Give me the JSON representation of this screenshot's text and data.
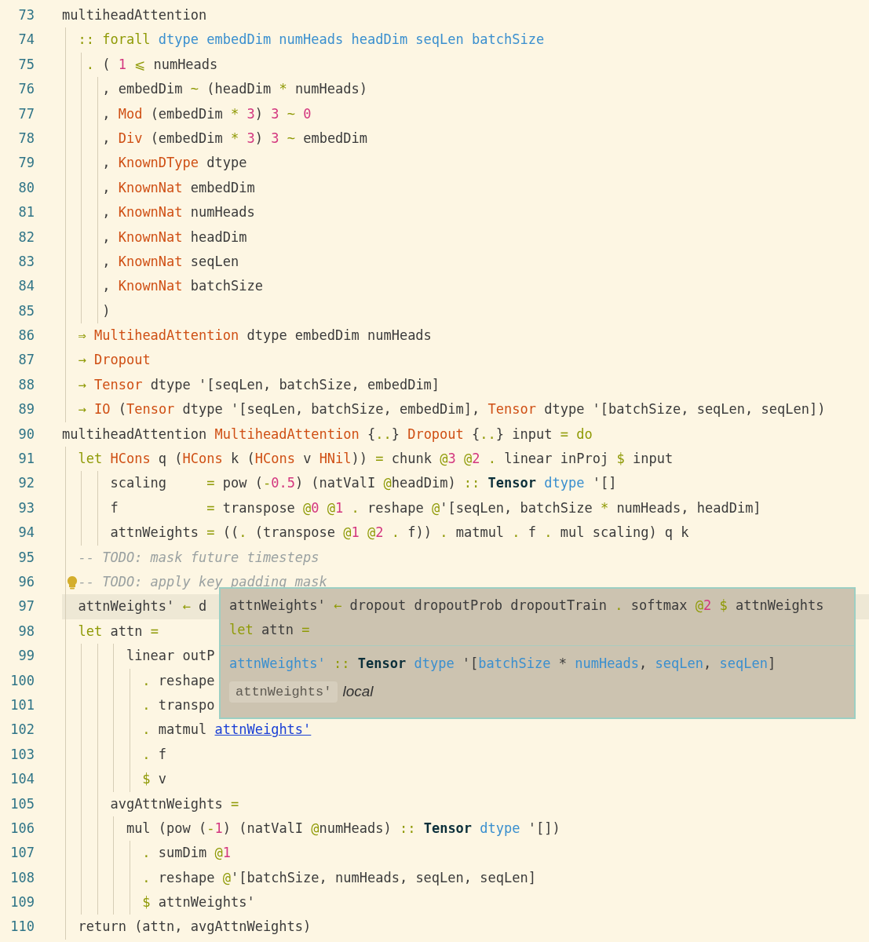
{
  "lines": [
    {
      "number": "73",
      "current": false,
      "lightbulb": false,
      "tokens": [
        {
          "text": "multiheadAttention",
          "kind": "plain"
        }
      ]
    },
    {
      "number": "74",
      "current": false,
      "lightbulb": false,
      "tokens": [
        {
          "text": "  :: forall",
          "kind": "op"
        },
        {
          "text": " dtype embedDim numHeads headDim seqLen batchSize",
          "kind": "tyvar"
        }
      ]
    },
    {
      "number": "75",
      "current": false,
      "lightbulb": false,
      "tokens": [
        {
          "text": "   .",
          "kind": "op"
        },
        {
          "text": " ( ",
          "kind": "plain"
        },
        {
          "text": "1",
          "kind": "num"
        },
        {
          "text": " ⩽",
          "kind": "op"
        },
        {
          "text": " numHeads",
          "kind": "plain"
        }
      ]
    },
    {
      "number": "76",
      "current": false,
      "lightbulb": false,
      "tokens": [
        {
          "text": "     , embedDim",
          "kind": "plain"
        },
        {
          "text": " ~",
          "kind": "op"
        },
        {
          "text": " (headDim",
          "kind": "plain"
        },
        {
          "text": " *",
          "kind": "op"
        },
        {
          "text": " numHeads)",
          "kind": "plain"
        }
      ]
    },
    {
      "number": "77",
      "current": false,
      "lightbulb": false,
      "tokens": [
        {
          "text": "     , ",
          "kind": "plain"
        },
        {
          "text": "Mod",
          "kind": "con"
        },
        {
          "text": " (embedDim",
          "kind": "plain"
        },
        {
          "text": " *",
          "kind": "op"
        },
        {
          "text": " 3",
          "kind": "num"
        },
        {
          "text": ") ",
          "kind": "plain"
        },
        {
          "text": "3",
          "kind": "num"
        },
        {
          "text": " ~",
          "kind": "op"
        },
        {
          "text": " 0",
          "kind": "num"
        }
      ]
    },
    {
      "number": "78",
      "current": false,
      "lightbulb": false,
      "tokens": [
        {
          "text": "     , ",
          "kind": "plain"
        },
        {
          "text": "Div",
          "kind": "con"
        },
        {
          "text": " (embedDim",
          "kind": "plain"
        },
        {
          "text": " *",
          "kind": "op"
        },
        {
          "text": " 3",
          "kind": "num"
        },
        {
          "text": ") ",
          "kind": "plain"
        },
        {
          "text": "3",
          "kind": "num"
        },
        {
          "text": " ~",
          "kind": "op"
        },
        {
          "text": " embedDim",
          "kind": "plain"
        }
      ]
    },
    {
      "number": "79",
      "current": false,
      "lightbulb": false,
      "tokens": [
        {
          "text": "     , ",
          "kind": "plain"
        },
        {
          "text": "KnownDType",
          "kind": "con"
        },
        {
          "text": " dtype",
          "kind": "plain"
        }
      ]
    },
    {
      "number": "80",
      "current": false,
      "lightbulb": false,
      "tokens": [
        {
          "text": "     , ",
          "kind": "plain"
        },
        {
          "text": "KnownNat",
          "kind": "con"
        },
        {
          "text": " embedDim",
          "kind": "plain"
        }
      ]
    },
    {
      "number": "81",
      "current": false,
      "lightbulb": false,
      "tokens": [
        {
          "text": "     , ",
          "kind": "plain"
        },
        {
          "text": "KnownNat",
          "kind": "con"
        },
        {
          "text": " numHeads",
          "kind": "plain"
        }
      ]
    },
    {
      "number": "82",
      "current": false,
      "lightbulb": false,
      "tokens": [
        {
          "text": "     , ",
          "kind": "plain"
        },
        {
          "text": "KnownNat",
          "kind": "con"
        },
        {
          "text": " headDim",
          "kind": "plain"
        }
      ]
    },
    {
      "number": "83",
      "current": false,
      "lightbulb": false,
      "tokens": [
        {
          "text": "     , ",
          "kind": "plain"
        },
        {
          "text": "KnownNat",
          "kind": "con"
        },
        {
          "text": " seqLen",
          "kind": "plain"
        }
      ]
    },
    {
      "number": "84",
      "current": false,
      "lightbulb": false,
      "tokens": [
        {
          "text": "     , ",
          "kind": "plain"
        },
        {
          "text": "KnownNat",
          "kind": "con"
        },
        {
          "text": " batchSize",
          "kind": "plain"
        }
      ]
    },
    {
      "number": "85",
      "current": false,
      "lightbulb": false,
      "tokens": [
        {
          "text": "     )",
          "kind": "plain"
        }
      ]
    },
    {
      "number": "86",
      "current": false,
      "lightbulb": false,
      "tokens": [
        {
          "text": "  ⇒",
          "kind": "op"
        },
        {
          "text": " MultiheadAttention",
          "kind": "con"
        },
        {
          "text": " dtype embedDim numHeads",
          "kind": "plain"
        }
      ]
    },
    {
      "number": "87",
      "current": false,
      "lightbulb": false,
      "tokens": [
        {
          "text": "  →",
          "kind": "op"
        },
        {
          "text": " Dropout",
          "kind": "con"
        }
      ]
    },
    {
      "number": "88",
      "current": false,
      "lightbulb": false,
      "tokens": [
        {
          "text": "  →",
          "kind": "op"
        },
        {
          "text": " Tensor",
          "kind": "con"
        },
        {
          "text": " dtype '[seqLen, batchSize, embedDim]",
          "kind": "plain"
        }
      ]
    },
    {
      "number": "89",
      "current": false,
      "lightbulb": false,
      "tokens": [
        {
          "text": "  →",
          "kind": "op"
        },
        {
          "text": " IO",
          "kind": "con"
        },
        {
          "text": " (",
          "kind": "plain"
        },
        {
          "text": "Tensor",
          "kind": "con"
        },
        {
          "text": " dtype '[seqLen, batchSize, embedDim], ",
          "kind": "plain"
        },
        {
          "text": "Tensor",
          "kind": "con"
        },
        {
          "text": " dtype '[batchSize, seqLen, seqLen])",
          "kind": "plain"
        }
      ]
    },
    {
      "number": "90",
      "current": false,
      "lightbulb": false,
      "tokens": [
        {
          "text": "multiheadAttention ",
          "kind": "plain"
        },
        {
          "text": "MultiheadAttention",
          "kind": "con"
        },
        {
          "text": " {",
          "kind": "plain"
        },
        {
          "text": "..",
          "kind": "op"
        },
        {
          "text": "} ",
          "kind": "plain"
        },
        {
          "text": "Dropout",
          "kind": "con"
        },
        {
          "text": " {",
          "kind": "plain"
        },
        {
          "text": "..",
          "kind": "op"
        },
        {
          "text": "} input ",
          "kind": "plain"
        },
        {
          "text": "= do",
          "kind": "op"
        }
      ]
    },
    {
      "number": "91",
      "current": false,
      "lightbulb": false,
      "tokens": [
        {
          "text": "  let",
          "kind": "op"
        },
        {
          "text": " HCons",
          "kind": "con"
        },
        {
          "text": " q (",
          "kind": "plain"
        },
        {
          "text": "HCons",
          "kind": "con"
        },
        {
          "text": " k (",
          "kind": "plain"
        },
        {
          "text": "HCons",
          "kind": "con"
        },
        {
          "text": " v ",
          "kind": "plain"
        },
        {
          "text": "HNil",
          "kind": "con"
        },
        {
          "text": ")) ",
          "kind": "plain"
        },
        {
          "text": "=",
          "kind": "op"
        },
        {
          "text": " chunk ",
          "kind": "plain"
        },
        {
          "text": "@",
          "kind": "op"
        },
        {
          "text": "3",
          "kind": "num"
        },
        {
          "text": " @",
          "kind": "op"
        },
        {
          "text": "2",
          "kind": "num"
        },
        {
          "text": " .",
          "kind": "op"
        },
        {
          "text": " linear inProj ",
          "kind": "plain"
        },
        {
          "text": "$",
          "kind": "op"
        },
        {
          "text": " input",
          "kind": "plain"
        }
      ]
    },
    {
      "number": "92",
      "current": false,
      "lightbulb": false,
      "tokens": [
        {
          "text": "      scaling     ",
          "kind": "plain"
        },
        {
          "text": "=",
          "kind": "op"
        },
        {
          "text": " pow (",
          "kind": "plain"
        },
        {
          "text": "-",
          "kind": "op"
        },
        {
          "text": "0.5",
          "kind": "num"
        },
        {
          "text": ") (natValI ",
          "kind": "plain"
        },
        {
          "text": "@",
          "kind": "op"
        },
        {
          "text": "headDim) ",
          "kind": "plain"
        },
        {
          "text": "::",
          "kind": "op"
        },
        {
          "text": " Tensor",
          "kind": "strong"
        },
        {
          "text": " dtype",
          "kind": "tyvar"
        },
        {
          "text": " '[]",
          "kind": "plain"
        }
      ]
    },
    {
      "number": "93",
      "current": false,
      "lightbulb": false,
      "tokens": [
        {
          "text": "      f           ",
          "kind": "plain"
        },
        {
          "text": "=",
          "kind": "op"
        },
        {
          "text": " transpose ",
          "kind": "plain"
        },
        {
          "text": "@",
          "kind": "op"
        },
        {
          "text": "0",
          "kind": "num"
        },
        {
          "text": " @",
          "kind": "op"
        },
        {
          "text": "1",
          "kind": "num"
        },
        {
          "text": " .",
          "kind": "op"
        },
        {
          "text": " reshape ",
          "kind": "plain"
        },
        {
          "text": "@",
          "kind": "op"
        },
        {
          "text": "'[seqLen, batchSize ",
          "kind": "plain"
        },
        {
          "text": "*",
          "kind": "op"
        },
        {
          "text": " numHeads, headDim]",
          "kind": "plain"
        }
      ]
    },
    {
      "number": "94",
      "current": false,
      "lightbulb": false,
      "tokens": [
        {
          "text": "      attnWeights ",
          "kind": "plain"
        },
        {
          "text": "=",
          "kind": "op"
        },
        {
          "text": " ((",
          "kind": "plain"
        },
        {
          "text": ".",
          "kind": "op"
        },
        {
          "text": " (transpose ",
          "kind": "plain"
        },
        {
          "text": "@",
          "kind": "op"
        },
        {
          "text": "1",
          "kind": "num"
        },
        {
          "text": " @",
          "kind": "op"
        },
        {
          "text": "2",
          "kind": "num"
        },
        {
          "text": " .",
          "kind": "op"
        },
        {
          "text": " f)) ",
          "kind": "plain"
        },
        {
          "text": ".",
          "kind": "op"
        },
        {
          "text": " matmul ",
          "kind": "plain"
        },
        {
          "text": ".",
          "kind": "op"
        },
        {
          "text": " f ",
          "kind": "plain"
        },
        {
          "text": ".",
          "kind": "op"
        },
        {
          "text": " mul scaling) q k",
          "kind": "plain"
        }
      ]
    },
    {
      "number": "95",
      "current": false,
      "lightbulb": false,
      "tokens": [
        {
          "text": "  -- TODO: mask future timesteps",
          "kind": "comment"
        }
      ]
    },
    {
      "number": "96",
      "current": false,
      "lightbulb": true,
      "tokens": [
        {
          "text": "  -- TODO: apply key padding mask",
          "kind": "comment"
        }
      ]
    },
    {
      "number": "97",
      "current": true,
      "lightbulb": false,
      "tokens": [
        {
          "text": "  attnWeights' ",
          "kind": "plain"
        },
        {
          "text": "←",
          "kind": "op"
        },
        {
          "text": " d",
          "kind": "plain"
        }
      ]
    },
    {
      "number": "98",
      "current": false,
      "lightbulb": false,
      "tokens": [
        {
          "text": "  let",
          "kind": "op"
        },
        {
          "text": " attn ",
          "kind": "plain"
        },
        {
          "text": "=",
          "kind": "op"
        }
      ]
    },
    {
      "number": "99",
      "current": false,
      "lightbulb": false,
      "tokens": [
        {
          "text": "        linear outP",
          "kind": "plain"
        }
      ]
    },
    {
      "number": "100",
      "current": false,
      "lightbulb": false,
      "tokens": [
        {
          "text": "          .",
          "kind": "op"
        },
        {
          "text": " reshape",
          "kind": "plain"
        }
      ]
    },
    {
      "number": "101",
      "current": false,
      "lightbulb": false,
      "tokens": [
        {
          "text": "          .",
          "kind": "op"
        },
        {
          "text": " transpo",
          "kind": "plain"
        }
      ]
    },
    {
      "number": "102",
      "current": false,
      "lightbulb": false,
      "tokens": [
        {
          "text": "          .",
          "kind": "op"
        },
        {
          "text": " matmul ",
          "kind": "plain"
        },
        {
          "text": "attnWeights'",
          "kind": "link"
        }
      ]
    },
    {
      "number": "103",
      "current": false,
      "lightbulb": false,
      "tokens": [
        {
          "text": "          .",
          "kind": "op"
        },
        {
          "text": " f",
          "kind": "plain"
        }
      ]
    },
    {
      "number": "104",
      "current": false,
      "lightbulb": false,
      "tokens": [
        {
          "text": "          $",
          "kind": "op"
        },
        {
          "text": " v",
          "kind": "plain"
        }
      ]
    },
    {
      "number": "105",
      "current": false,
      "lightbulb": false,
      "tokens": [
        {
          "text": "      avgAttnWeights ",
          "kind": "plain"
        },
        {
          "text": "=",
          "kind": "op"
        }
      ]
    },
    {
      "number": "106",
      "current": false,
      "lightbulb": false,
      "tokens": [
        {
          "text": "        mul (pow (",
          "kind": "plain"
        },
        {
          "text": "-",
          "kind": "op"
        },
        {
          "text": "1",
          "kind": "num"
        },
        {
          "text": ") (natValI ",
          "kind": "plain"
        },
        {
          "text": "@",
          "kind": "op"
        },
        {
          "text": "numHeads) ",
          "kind": "plain"
        },
        {
          "text": "::",
          "kind": "op"
        },
        {
          "text": " Tensor",
          "kind": "strong"
        },
        {
          "text": " dtype",
          "kind": "tyvar"
        },
        {
          "text": " '[])",
          "kind": "plain"
        }
      ]
    },
    {
      "number": "107",
      "current": false,
      "lightbulb": false,
      "tokens": [
        {
          "text": "          .",
          "kind": "op"
        },
        {
          "text": " sumDim ",
          "kind": "plain"
        },
        {
          "text": "@",
          "kind": "op"
        },
        {
          "text": "1",
          "kind": "num"
        }
      ]
    },
    {
      "number": "108",
      "current": false,
      "lightbulb": false,
      "tokens": [
        {
          "text": "          .",
          "kind": "op"
        },
        {
          "text": " reshape ",
          "kind": "plain"
        },
        {
          "text": "@",
          "kind": "op"
        },
        {
          "text": "'[batchSize, numHeads, seqLen, seqLen]",
          "kind": "plain"
        }
      ]
    },
    {
      "number": "109",
      "current": false,
      "lightbulb": false,
      "tokens": [
        {
          "text": "          $",
          "kind": "op"
        },
        {
          "text": " attnWeights'",
          "kind": "plain"
        }
      ]
    },
    {
      "number": "110",
      "current": false,
      "lightbulb": false,
      "tokens": [
        {
          "text": "  return (attn, avgAttnWeights)",
          "kind": "plain"
        }
      ]
    }
  ],
  "tooltip": {
    "code": [
      [
        {
          "text": "attnWeights' ",
          "kind": "plain"
        },
        {
          "text": "←",
          "kind": "op"
        },
        {
          "text": " dropout dropoutProb dropoutTrain ",
          "kind": "plain"
        },
        {
          "text": ".",
          "kind": "op"
        },
        {
          "text": " softmax ",
          "kind": "plain"
        },
        {
          "text": "@",
          "kind": "op"
        },
        {
          "text": "2",
          "kind": "num"
        },
        {
          "text": " $",
          "kind": "op"
        },
        {
          "text": " attnWeights",
          "kind": "plain"
        }
      ],
      [
        {
          "text": "let",
          "kind": "op"
        },
        {
          "text": " attn ",
          "kind": "plain"
        },
        {
          "text": "=",
          "kind": "op"
        }
      ]
    ],
    "signature": [
      {
        "text": "attnWeights'",
        "kind": "tyvar"
      },
      {
        "text": " ::",
        "kind": "op"
      },
      {
        "text": " Tensor",
        "kind": "strong"
      },
      {
        "text": " dtype",
        "kind": "tyvar"
      },
      {
        "text": " '[",
        "kind": "plain"
      },
      {
        "text": "batchSize",
        "kind": "tyvar"
      },
      {
        "text": " * ",
        "kind": "plain"
      },
      {
        "text": "numHeads",
        "kind": "tyvar"
      },
      {
        "text": ", ",
        "kind": "plain"
      },
      {
        "text": "seqLen",
        "kind": "tyvar"
      },
      {
        "text": ", ",
        "kind": "plain"
      },
      {
        "text": "seqLen",
        "kind": "tyvar"
      },
      {
        "text": "]",
        "kind": "plain"
      }
    ],
    "name": "attnWeights'",
    "scope": "local"
  }
}
